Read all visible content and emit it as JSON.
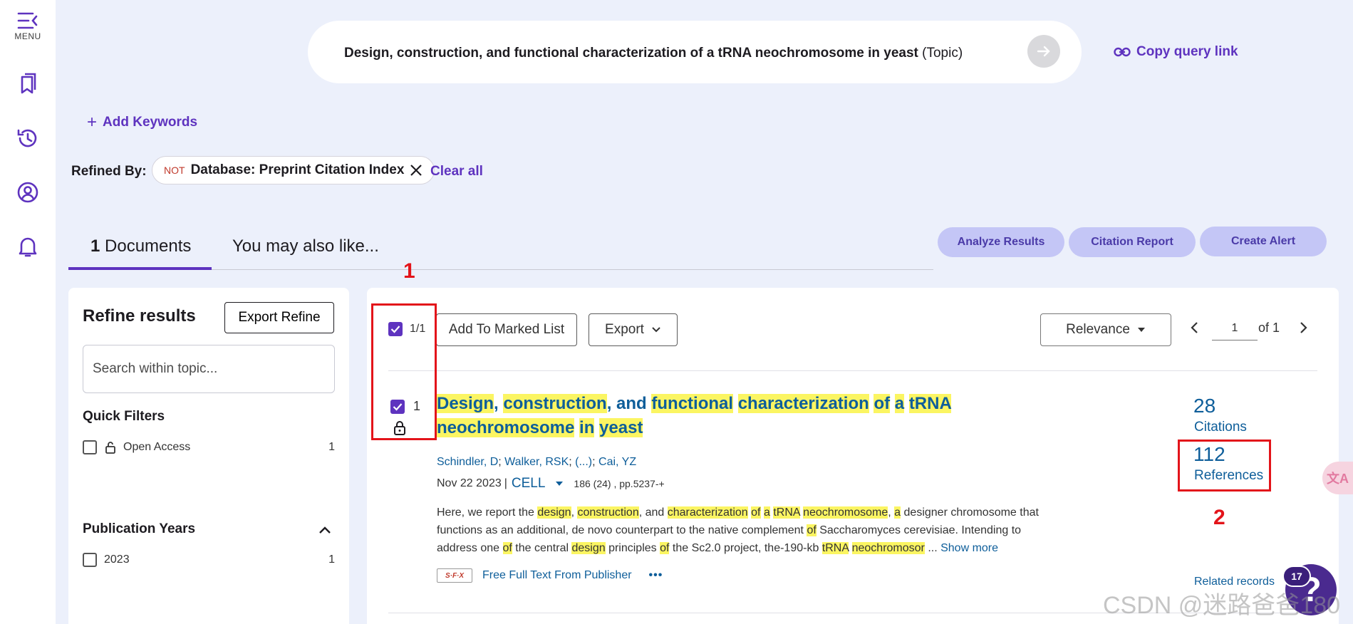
{
  "rail": {
    "menu_label": "MENU"
  },
  "search": {
    "query_bold": "Design, construction, and functional characterization of a tRNA neochromosome in yeast",
    "query_field": " (Topic)",
    "copy_link_label": "Copy query link"
  },
  "add_keywords_label": "Add Keywords",
  "refined": {
    "label": "Refined By:",
    "chip_not": "NOT",
    "chip_text": "Database: Preprint Citation Index",
    "clear_all": "Clear all"
  },
  "tabs": {
    "documents_count": "1",
    "documents_label": " Documents",
    "also_like": "You may also like..."
  },
  "actions": {
    "analyze": "Analyze Results",
    "citation_report": "Citation Report",
    "create_alert": "Create Alert"
  },
  "refine": {
    "title": "Refine results",
    "export_label": "Export Refine",
    "search_placeholder": "Search within topic...",
    "quick_filters_title": "Quick Filters",
    "open_access_label": "Open Access",
    "open_access_count": "1",
    "pub_years_title": "Publication Years",
    "year_2023_label": "2023",
    "year_2023_count": "1"
  },
  "toolbar": {
    "select_count": "1/1",
    "add_marked": "Add To Marked List",
    "export": "Export",
    "sort": "Relevance",
    "page_value": "1",
    "page_of": "of 1"
  },
  "record": {
    "index": "1",
    "title_parts": [
      "Design",
      ", ",
      "construction",
      ", and ",
      "functional",
      " ",
      "characterization",
      " ",
      "of",
      " ",
      "a",
      " ",
      "tRNA",
      " ",
      "neochromosome",
      " ",
      "in",
      " ",
      "yeast"
    ],
    "authors": {
      "a1": "Schindler, D",
      "a2": "Walker, RSK",
      "ellipsis": "(...)",
      "a3": "Cai, YZ"
    },
    "date": "Nov 22 2023",
    "journal": "CELL",
    "volume": "186 (24) , pp.5237-+",
    "abstract_parts": [
      {
        "t": "Here, we report the ",
        "h": false
      },
      {
        "t": "design",
        "h": true
      },
      {
        "t": ", ",
        "h": false
      },
      {
        "t": "construction",
        "h": true
      },
      {
        "t": ", and ",
        "h": false
      },
      {
        "t": "characterization",
        "h": true
      },
      {
        "t": " ",
        "h": false
      },
      {
        "t": "of",
        "h": true
      },
      {
        "t": " ",
        "h": false
      },
      {
        "t": "a",
        "h": true
      },
      {
        "t": " ",
        "h": false
      },
      {
        "t": "tRNA",
        "h": true
      },
      {
        "t": " ",
        "h": false
      },
      {
        "t": "neochromosome",
        "h": true
      },
      {
        "t": ", ",
        "h": false
      },
      {
        "t": "a",
        "h": true
      },
      {
        "t": " designer chromosome that functions as an additional, de novo counterpart to the native complement ",
        "h": false
      },
      {
        "t": "of",
        "h": true
      },
      {
        "t": " Saccharomyces cerevisiae. Intending to address one ",
        "h": false
      },
      {
        "t": "of",
        "h": true
      },
      {
        "t": " the central ",
        "h": false
      },
      {
        "t": "design",
        "h": true
      },
      {
        "t": " principles ",
        "h": false
      },
      {
        "t": "of",
        "h": true
      },
      {
        "t": " the Sc2.0 project, the-190-kb ",
        "h": false
      },
      {
        "t": "tRNA",
        "h": true
      },
      {
        "t": " ",
        "h": false
      },
      {
        "t": "neochromosor",
        "h": true
      },
      {
        "t": " ... ",
        "h": false
      }
    ],
    "show_more": "Show more",
    "sfx_label": "S·F·X",
    "full_text": "Free Full Text From Publisher",
    "more_dots": "•••",
    "citations_num": "28",
    "citations_label": "Citations",
    "references_num": "112",
    "references_label": "References",
    "related": "Related records"
  },
  "annotations": {
    "n1": "1",
    "n2": "2"
  },
  "help": {
    "badge": "17",
    "glyph": "?"
  },
  "translate_glyph": "文A",
  "watermark": "CSDN @迷路爸爸180",
  "colors": {
    "accent": "#5e33bf",
    "link": "#0e5e9a",
    "highlight": "#fbf562",
    "annotation": "#e3141a",
    "pill": "#c4c6f6"
  }
}
